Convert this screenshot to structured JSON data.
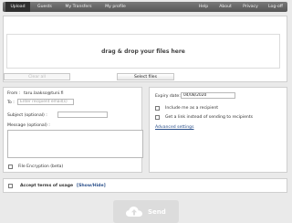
{
  "nav": {
    "left": [
      {
        "label": "Upload",
        "active": true
      },
      {
        "label": "Guests"
      },
      {
        "label": "My Transfers"
      },
      {
        "label": "My profile"
      }
    ],
    "right": [
      {
        "label": "Help"
      },
      {
        "label": "About"
      },
      {
        "label": "Privacy"
      },
      {
        "label": "Log-off"
      }
    ]
  },
  "upload": {
    "drop_text": "drag & drop your files here",
    "clear_all": "Clear all",
    "select_files": "Select files"
  },
  "form": {
    "from_label": "From :",
    "from_value": "taru.laakso@tuni.fi",
    "to_label": "To :",
    "to_placeholder": "Enter recipient email(s)",
    "subject_label": "Subject (optional) :",
    "message_label": "Message (optional) :",
    "file_encryption": "File Encryption (beta)"
  },
  "options": {
    "expiry_label": "Expiry date:",
    "expiry_value": "04/08/2020",
    "include_me": "Include me as a recipient",
    "get_link": "Get a link instead of sending to recipients",
    "advanced": "Advanced settings"
  },
  "terms": {
    "label": "Accept terms of usage",
    "toggle": "[Show/Hide]"
  },
  "send": {
    "label": "Send",
    "icon": "cloud-upload-icon"
  }
}
